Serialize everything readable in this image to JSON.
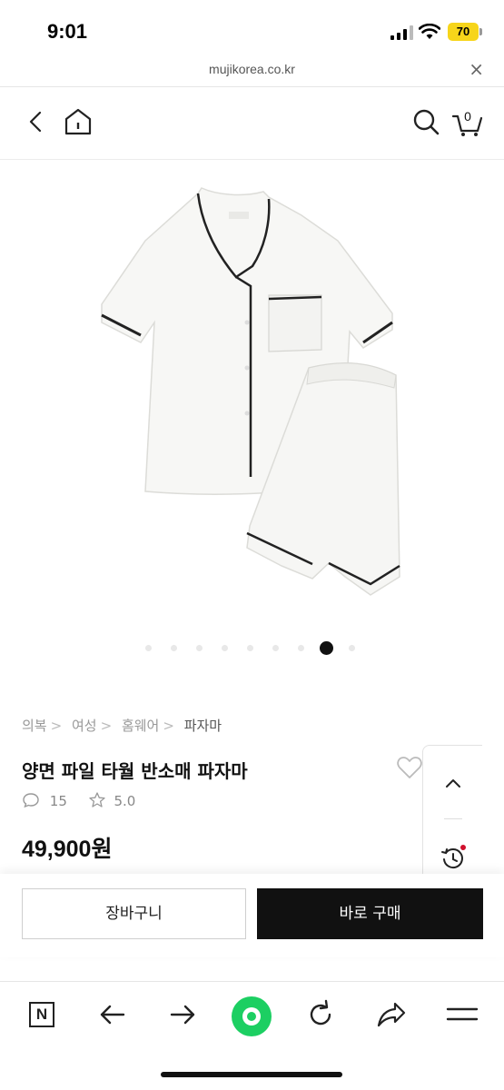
{
  "status_bar": {
    "time": "9:01",
    "battery": "70"
  },
  "url_bar": {
    "domain": "mujikorea.co.kr",
    "close": "×"
  },
  "header": {
    "cart_count": "0"
  },
  "gallery": {
    "total_slides": 9,
    "active_index": 7
  },
  "breadcrumb": [
    "의복",
    "여성",
    "홈웨어",
    "파자마"
  ],
  "breadcrumb_separator": ">",
  "product": {
    "title": "양면 파일 타월 반소매 파자마",
    "review_count": "15",
    "rating": "5.0",
    "price": "49,900원"
  },
  "actions": {
    "cart_label": "장바구니",
    "buy_label": "바로 구매"
  },
  "colors": {
    "accent_green": "#1ccf62",
    "battery_yellow": "#f7d51a",
    "buy_button": "#111111"
  }
}
